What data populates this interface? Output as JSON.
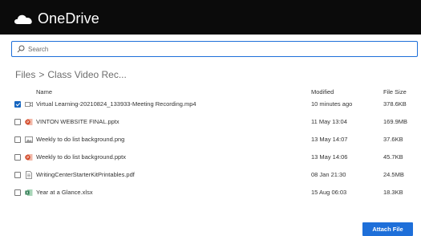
{
  "app": {
    "title": "OneDrive",
    "logo_icon": "onedrive-cloud-icon"
  },
  "search": {
    "placeholder": "Search",
    "icon": "search-icon"
  },
  "breadcrumb": {
    "root": "Files",
    "separator": ">",
    "current": "Class Video Rec..."
  },
  "table": {
    "headers": {
      "name": "Name",
      "modified": "Modified",
      "size": "File Size"
    },
    "rows": [
      {
        "name": "Virtual Learning-20210824_133933-Meeting Recording.mp4",
        "modified": "10 minutes ago",
        "size": "378.6KB",
        "checked": true,
        "icon": "video-file-icon"
      },
      {
        "name": "VINTON WEBSITE FINAL.pptx",
        "modified": "11 May 13:04",
        "size": "169.9MB",
        "checked": false,
        "icon": "powerpoint-file-icon"
      },
      {
        "name": "Weekly to do list background.png",
        "modified": "13 May 14:07",
        "size": "37.6KB",
        "checked": false,
        "icon": "image-file-icon"
      },
      {
        "name": "Weekly to do list background.pptx",
        "modified": "13 May 14:06",
        "size": "45.7KB",
        "checked": false,
        "icon": "powerpoint-file-icon"
      },
      {
        "name": "WritingCenterStarterKitPrintables.pdf",
        "modified": "08 Jan 21:30",
        "size": "24.5MB",
        "checked": false,
        "icon": "pdf-file-icon"
      },
      {
        "name": "Year at a Glance.xlsx",
        "modified": "15 Aug 06:03",
        "size": "18.3KB",
        "checked": false,
        "icon": "excel-file-icon"
      }
    ]
  },
  "actions": {
    "attach_label": "Attach File"
  },
  "colors": {
    "topbar": "#0b0b0b",
    "accent": "#1e6fd9",
    "checkbox_checked": "#1565c0"
  }
}
